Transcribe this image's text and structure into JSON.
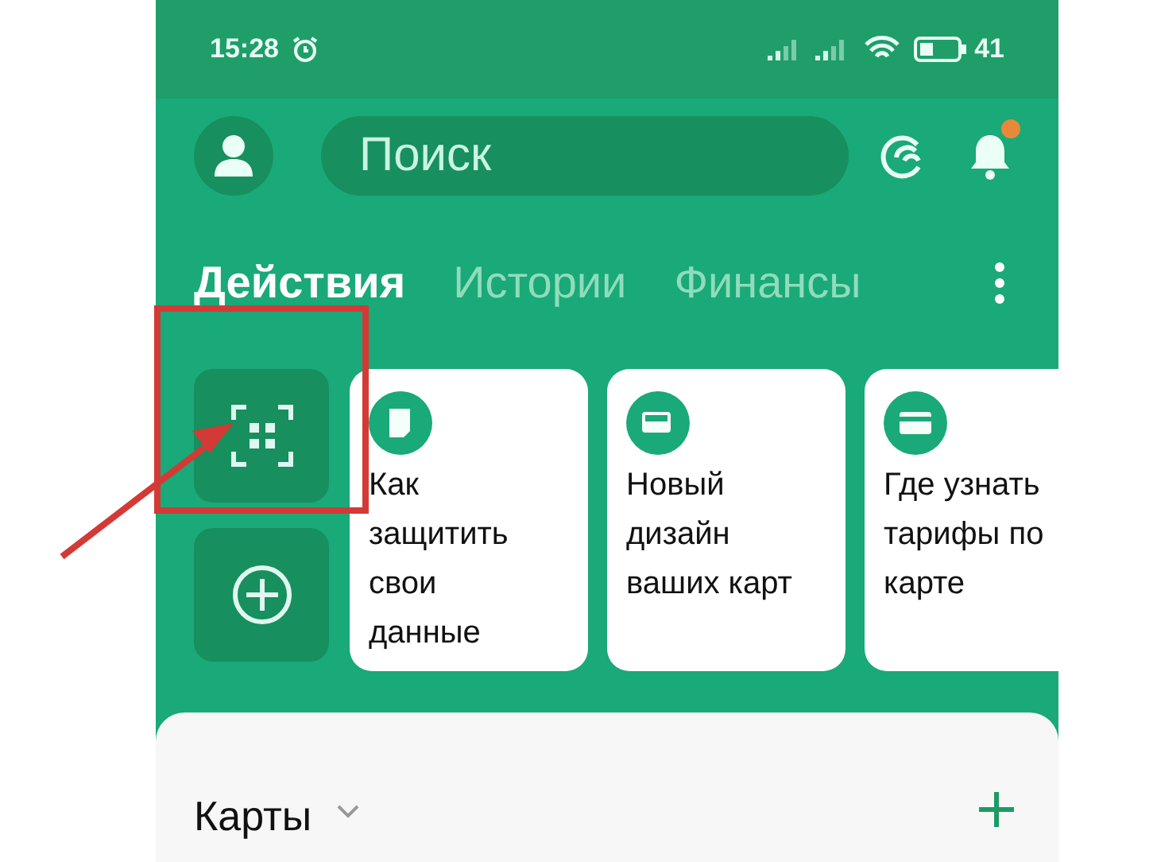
{
  "status_bar": {
    "time": "15:28",
    "battery": "41"
  },
  "header": {
    "search": {
      "placeholder": "Поиск"
    },
    "bell": {
      "badge": true
    }
  },
  "tabs": [
    {
      "label": "Действия",
      "selected": true
    },
    {
      "label": "Истории",
      "selected": false
    },
    {
      "label": "Финансы",
      "selected": false
    }
  ],
  "quick_actions": [
    {
      "kind": "scan"
    },
    {
      "kind": "add"
    }
  ],
  "stories": [
    {
      "kind": "document",
      "text": "Как защитить свои данные"
    },
    {
      "kind": "cards",
      "text": "Новый дизайн ваших карт"
    },
    {
      "kind": "card",
      "text": "Где узнать тарифы по карте"
    }
  ],
  "cards_section": {
    "title": "Карты"
  }
}
